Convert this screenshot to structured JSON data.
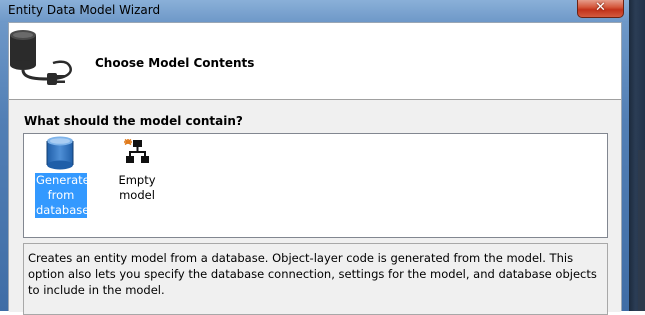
{
  "window": {
    "title": "Entity Data Model Wizard",
    "close_glyph": "✕"
  },
  "header": {
    "heading": "Choose Model Contents",
    "icon": "database-plug-icon"
  },
  "content": {
    "question": "What should the model contain?",
    "options": [
      {
        "label": "Generate from database",
        "icon": "database-icon",
        "selected": true
      },
      {
        "label": "Empty model",
        "icon": "empty-model-icon",
        "selected": false
      }
    ],
    "description": "Creates an entity model from a database. Object-layer code is generated from the model. This option also lets you specify the database connection, settings for the model, and database objects to include in the model."
  },
  "colors": {
    "selection": "#3399ff",
    "close_button": "#c2321a",
    "window_frame": "#6e98c8"
  }
}
